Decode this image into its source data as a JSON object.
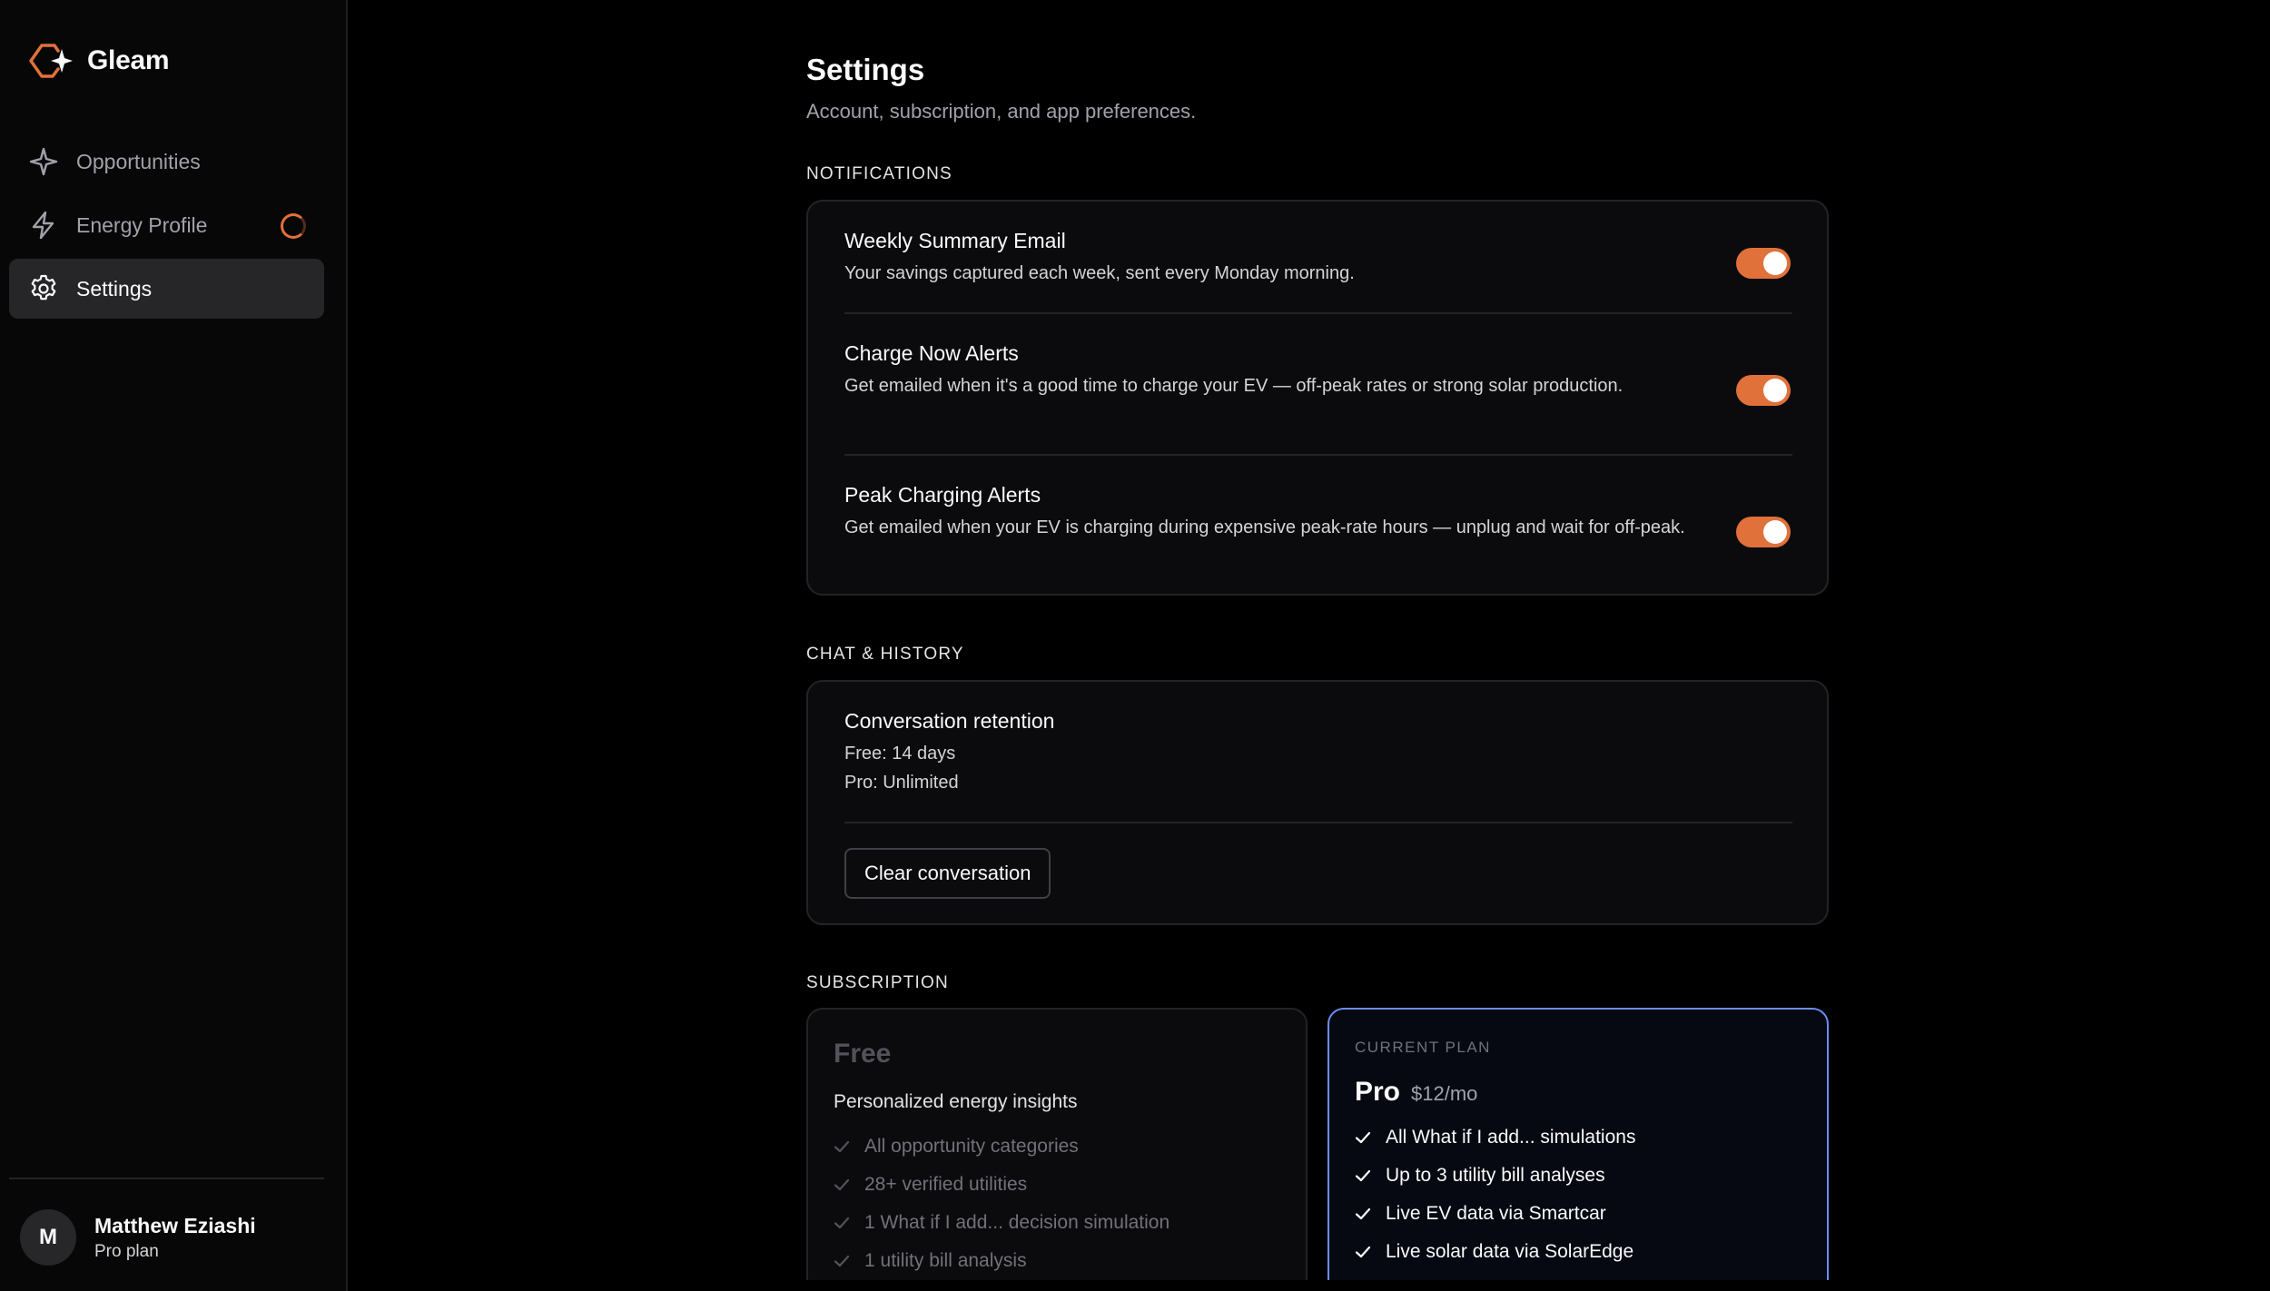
{
  "app": {
    "name": "Gleam",
    "accent": "#e0713a"
  },
  "sidebar": {
    "items": [
      {
        "label": "Opportunities",
        "icon": "sparkle-icon"
      },
      {
        "label": "Energy Profile",
        "icon": "lightning-icon",
        "badge": "loading-ring"
      },
      {
        "label": "Settings",
        "icon": "gear-icon",
        "active": true
      }
    ],
    "user": {
      "initial": "M",
      "name": "Matthew Eziashi",
      "plan": "Pro plan"
    }
  },
  "page": {
    "title": "Settings",
    "subtitle": "Account, subscription, and app preferences."
  },
  "notifications": {
    "label": "NOTIFICATIONS",
    "items": [
      {
        "title": "Weekly Summary Email",
        "desc": "Your savings captured each week, sent every Monday morning.",
        "enabled": true
      },
      {
        "title": "Charge Now Alerts",
        "desc": "Get emailed when it's a good time to charge your EV — off-peak rates or strong solar production.",
        "enabled": true
      },
      {
        "title": "Peak Charging Alerts",
        "desc": "Get emailed when your EV is charging during expensive peak-rate hours — unplug and wait for off-peak.",
        "enabled": true
      }
    ]
  },
  "chat": {
    "label": "CHAT & HISTORY",
    "retention_title": "Conversation retention",
    "free_line": "Free: 14 days",
    "pro_line": "Pro: Unlimited",
    "clear_button": "Clear conversation"
  },
  "subscription": {
    "label": "SUBSCRIPTION",
    "free": {
      "name": "Free",
      "tagline": "Personalized energy insights",
      "features": [
        "All opportunity categories",
        "28+ verified utilities",
        "1 What if I add... decision simulation",
        "1 utility bill analysis"
      ]
    },
    "pro": {
      "current_label": "CURRENT PLAN",
      "name": "Pro",
      "price": "$12/mo",
      "features": [
        "All What if I add... simulations",
        "Up to 3 utility bill analyses",
        "Live EV data via Smartcar",
        "Live solar data via SolarEdge"
      ]
    }
  }
}
